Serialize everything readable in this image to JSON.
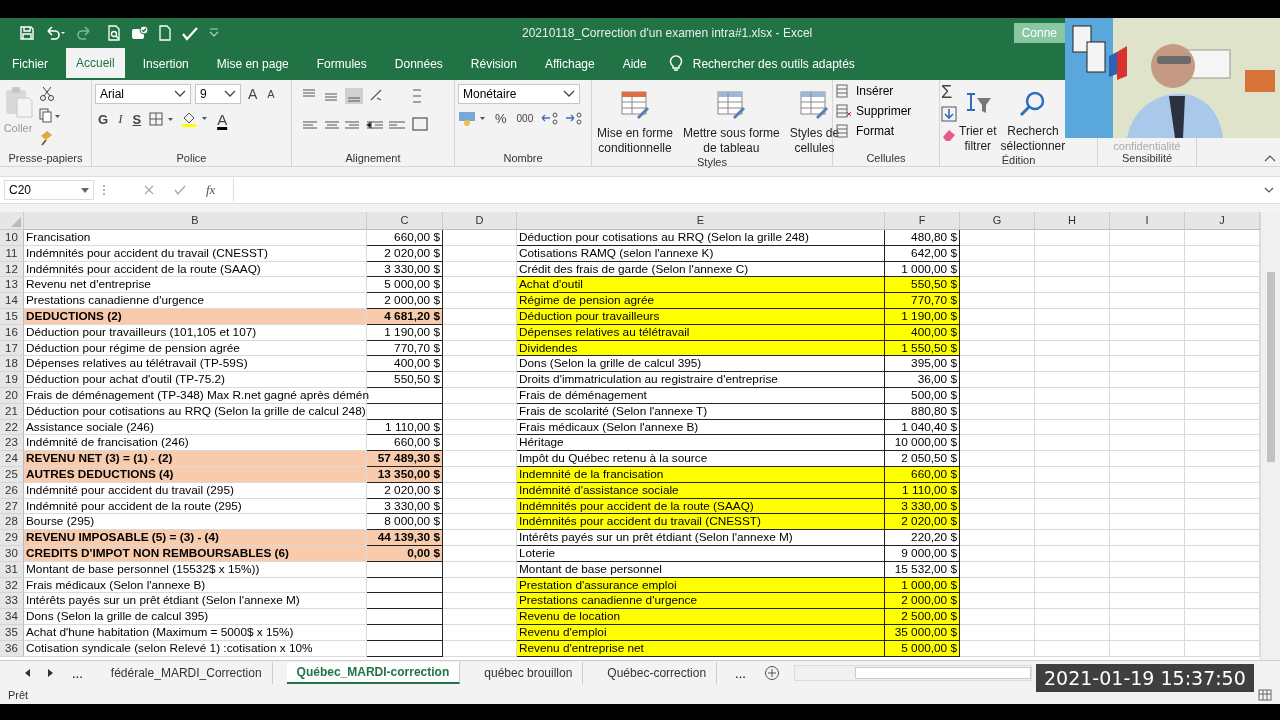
{
  "window": {
    "title": "20210118_Correction d'un examen intra#1.xlsx  -  Excel",
    "connect_button": "Conne"
  },
  "menu_tabs": [
    {
      "label": "Fichier",
      "selected": false
    },
    {
      "label": "Accueil",
      "selected": true
    },
    {
      "label": "Insertion",
      "selected": false
    },
    {
      "label": "Mise en page",
      "selected": false
    },
    {
      "label": "Formules",
      "selected": false
    },
    {
      "label": "Données",
      "selected": false
    },
    {
      "label": "Révision",
      "selected": false
    },
    {
      "label": "Affichage",
      "selected": false
    },
    {
      "label": "Aide",
      "selected": false
    }
  ],
  "tell_me": "Rechercher des outils adaptés",
  "ribbon": {
    "clipboard": {
      "paste": "Coller",
      "label": "Presse-papiers"
    },
    "font": {
      "name": "Arial",
      "size": "9",
      "grow": "A",
      "shrink": "A",
      "bold": "G",
      "italic": "I",
      "underline": "S",
      "font_color": "A",
      "label": "Police"
    },
    "alignment": {
      "label": "Alignement"
    },
    "number": {
      "format": "Monétaire",
      "percent": "%",
      "thousands": "000",
      "label": "Nombre"
    },
    "styles": {
      "buttons": [
        "Mise en forme\nconditionnelle",
        "Mettre sous forme\nde tableau",
        "Styles de\ncellules"
      ],
      "label": "Styles"
    },
    "cells": {
      "buttons": [
        "Insérer",
        "Supprimer",
        "Format"
      ],
      "label": "Cellules"
    },
    "editing": {
      "sum": "Σ",
      "buttons": [
        "Trier et\nfiltrer",
        "Recherch\nsélectionner"
      ],
      "label": "Édition"
    },
    "sensitivity": {
      "button": "confidentialité",
      "label": "Sensibilité"
    }
  },
  "formula_bar": {
    "name_box": "C20",
    "fx": "fx"
  },
  "sheet": {
    "columns": [
      "B",
      "C",
      "D",
      "E",
      "F",
      "G",
      "H",
      "I",
      "J"
    ],
    "rows": [
      {
        "row": "10",
        "label": "Francisation",
        "section": false,
        "amount": "660,00 $",
        "item": "Déduction pour cotisations au RRQ (Selon la grille 248)",
        "highlight": false,
        "value": "480,80 $"
      },
      {
        "row": "11",
        "label": "Indémnités pour accident du travail (CNESST)",
        "section": false,
        "amount": "2 020,00 $",
        "item": "Cotisations RAMQ (selon l'annexe K)",
        "highlight": false,
        "value": "642,00 $"
      },
      {
        "row": "12",
        "label": "Indémnités pour accident de la route (SAAQ)",
        "section": false,
        "amount": "3 330,00 $",
        "item": "Crédit des frais de garde (Selon l'annexe C)",
        "highlight": false,
        "value": "1 000,00 $"
      },
      {
        "row": "13",
        "label": "Revenu net d'entreprise",
        "section": false,
        "amount": "5 000,00 $",
        "item": "Achat d'outil",
        "highlight": true,
        "value": "550,50 $"
      },
      {
        "row": "14",
        "label": "Prestations canadienne d'urgence",
        "section": false,
        "amount": "2 000,00 $",
        "item": "Régime de pension agrée",
        "highlight": true,
        "value": "770,70 $"
      },
      {
        "row": "15",
        "label": "DEDUCTIONS (2)",
        "section": true,
        "amount": "4 681,20 $",
        "item": "Déduction pour travailleurs",
        "highlight": true,
        "value": "1 190,00 $"
      },
      {
        "row": "16",
        "label": "Déduction pour travailleurs (101,105 et 107)",
        "section": false,
        "amount": "1 190,00 $",
        "item": "Dépenses relatives au télétravail",
        "highlight": true,
        "value": "400,00 $"
      },
      {
        "row": "17",
        "label": "Déduction pour régime de pension agrée",
        "section": false,
        "amount": "770,70 $",
        "item": "Dividendes",
        "highlight": true,
        "value": "1 550,50 $"
      },
      {
        "row": "18",
        "label": "Dépenses relatives au télétravail (TP-59S)",
        "section": false,
        "amount": "400,00 $",
        "item": "Dons (Selon la grille de calcul 395)",
        "highlight": false,
        "value": "395,00 $"
      },
      {
        "row": "19",
        "label": "Déduction pour achat d'outil (TP-75.2)",
        "section": false,
        "amount": "550,50 $",
        "item": "Droits d'immatriculation au registraire d'entreprise",
        "highlight": false,
        "value": "36,00 $"
      },
      {
        "row": "20",
        "label": "Frais de déménagement (TP-348) Max R.net gagné après démén",
        "section": false,
        "item": "Frais de déménagement",
        "highlight": false,
        "value": "500,00 $"
      },
      {
        "row": "21",
        "label": "Déduction pour cotisations au RRQ (Selon la grille de calcul 248)",
        "section": false,
        "item": "Frais de scolarité (Selon l'annexe T)",
        "highlight": false,
        "value": "880,80 $"
      },
      {
        "row": "22",
        "label": "Assistance sociale (246)",
        "section": false,
        "amount": "1 110,00 $",
        "item": "Frais médicaux (Selon l'annexe B)",
        "highlight": false,
        "value": "1 040,40 $"
      },
      {
        "row": "23",
        "label": "Indémnité de francisation (246)",
        "section": false,
        "amount": "660,00 $",
        "item": "Héritage",
        "highlight": false,
        "value": "10 000,00 $"
      },
      {
        "row": "24",
        "label": "REVENU NET (3) = (1) - (2)",
        "section": true,
        "amount": "57 489,30 $",
        "item": "Impôt du Québec retenu à la source",
        "highlight": false,
        "value": "2 050,50 $"
      },
      {
        "row": "25",
        "label": "AUTRES DEDUCTIONS (4)",
        "section": true,
        "amount": "13 350,00 $",
        "item": "Indemnité  de la francisation",
        "highlight": true,
        "value": "660,00 $"
      },
      {
        "row": "26",
        "label": "Indémnité pour accident du travail (295)",
        "section": false,
        "amount": "2 020,00 $",
        "item": "Indémnité d'assistance sociale",
        "highlight": true,
        "value": "1 110,00 $"
      },
      {
        "row": "27",
        "label": "Indémnité pour accident de la route (295)",
        "section": false,
        "amount": "3 330,00 $",
        "item": "Indémnités pour accident de la route (SAAQ)",
        "highlight": true,
        "value": "3 330,00 $"
      },
      {
        "row": "28",
        "label": "Bourse (295)",
        "section": false,
        "amount": "8 000,00 $",
        "item": "Indémnités pour accident du travail (CNESST)",
        "highlight": true,
        "value": "2 020,00 $"
      },
      {
        "row": "29",
        "label": "REVENU IMPOSABLE (5) = (3) - (4)",
        "section": true,
        "amount": "44 139,30 $",
        "item": "Intérêts payés sur un prêt étdiant (Selon l'annexe M)",
        "highlight": false,
        "value": "220,20 $"
      },
      {
        "row": "30",
        "label": "CREDITS D'IMPOT NON REMBOURSABLES (6)",
        "section": true,
        "amount": "0,00 $",
        "item": "Loterie",
        "highlight": false,
        "value": "9 000,00 $"
      },
      {
        "row": "31",
        "label": "Montant de base personnel (15532$ x 15%))",
        "section": false,
        "item": "Montant de base personnel",
        "highlight": false,
        "value": "15 532,00 $"
      },
      {
        "row": "32",
        "label": "Frais médicaux (Selon l'annexe B)",
        "section": false,
        "item": "Prestation d'assurance emploi",
        "highlight": true,
        "value": "1 000,00 $"
      },
      {
        "row": "33",
        "label": "Intérêts payés sur un prêt étdiant (Selon l'annexe M)",
        "section": false,
        "item": "Prestations canadienne d'urgence",
        "highlight": true,
        "value": "2 000,00 $"
      },
      {
        "row": "34",
        "label": "Dons (Selon la grille de calcul 395)",
        "section": false,
        "item": "Revenu de location",
        "highlight": true,
        "value": "2 500,00 $"
      },
      {
        "row": "35",
        "label": "Achat d'hune habitation (Maximum = 5000$ x 15%)",
        "section": false,
        "item": "Revenu d'emploi",
        "highlight": true,
        "value": "35 000,00 $"
      },
      {
        "row": "36",
        "label": "Cotisation syndicale (selon Relevé 1) :cotisation x 10%",
        "section": false,
        "item": "Revenu d'entreprise net",
        "highlight": true,
        "value": "5 000,00 $"
      }
    ]
  },
  "sheet_tabs": {
    "more_left": "...",
    "tabs": [
      {
        "label": "fédérale_MARDI_Correction",
        "selected": false
      },
      {
        "label": "Québec_MARDI-correction",
        "selected": true
      },
      {
        "label": "québec brouillon",
        "selected": false
      },
      {
        "label": "Québec-correction",
        "selected": false
      }
    ],
    "more_right": "..."
  },
  "status": "Prêt",
  "timestamp": "2021-01-19 15:37:50"
}
